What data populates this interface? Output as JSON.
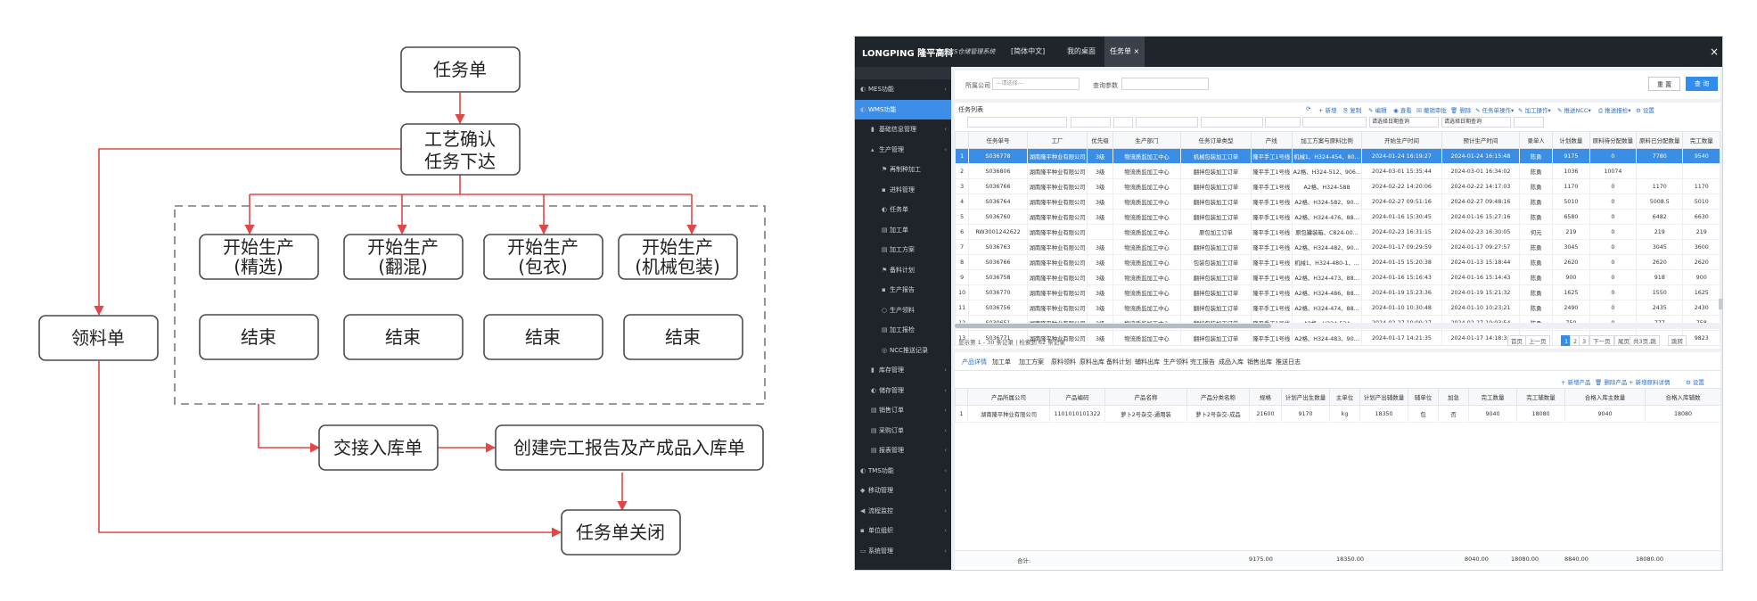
{
  "flow": {
    "nodes": {
      "task_order": "任务单",
      "confirm_line1": "工艺确认",
      "confirm_line2": "任务下达",
      "start1_line1": "开始生产",
      "start1_line2": "(精选)",
      "start2_line1": "开始生产",
      "start2_line2": "(翻混)",
      "start3_line1": "开始生产",
      "start3_line2": "(包衣)",
      "start4_line1": "开始生产",
      "start4_line2": "(机械包装)",
      "end1": "结束",
      "end2": "结束",
      "end3": "结束",
      "end4": "结束",
      "material_order": "领料单",
      "handover": "交接入库单",
      "report": "创建完工报告及产成品入库单",
      "close": "任务单关闭"
    },
    "colors": {
      "edge": "#e34646",
      "node_border": "#4a4a4a",
      "dashed_group": "#7a7a7a"
    }
  },
  "wms": {
    "brand": "LONGPING 隆平高科",
    "system_name": "WMS仓储管理系统",
    "top_tabs": [
      "[简体中文]",
      "我的桌面",
      "任务单 ×"
    ],
    "close_glyph": "×",
    "sidebar": [
      {
        "label": "MES功能",
        "level": 0,
        "icon": "◐"
      },
      {
        "label": "WMS功能",
        "level": 0,
        "icon": "◐",
        "active": true
      },
      {
        "label": "基础信息管理",
        "level": 1,
        "icon": "▮"
      },
      {
        "label": "生产管理",
        "level": 1,
        "icon": "▴"
      },
      {
        "label": "再制种加工",
        "level": 2,
        "icon": "⚑"
      },
      {
        "label": "进料管理",
        "level": 2,
        "icon": "▪"
      },
      {
        "label": "任务单",
        "level": 2,
        "icon": "◐"
      },
      {
        "label": "加工单",
        "level": 2,
        "icon": "▤"
      },
      {
        "label": "加工方案",
        "level": 2,
        "icon": "▤"
      },
      {
        "label": "备料计划",
        "level": 2,
        "icon": "⚑"
      },
      {
        "label": "生产报告",
        "level": 2,
        "icon": "▪"
      },
      {
        "label": "生产领料",
        "level": 2,
        "icon": "○"
      },
      {
        "label": "加工报检",
        "level": 2,
        "icon": "▤"
      },
      {
        "label": "NCC推送记录",
        "level": 2,
        "icon": "◎"
      },
      {
        "label": "库存管理",
        "level": 1,
        "icon": "▮"
      },
      {
        "label": "储存管理",
        "level": 1,
        "icon": "◐"
      },
      {
        "label": "销售订单",
        "level": 1,
        "icon": "▤"
      },
      {
        "label": "采购订单",
        "level": 1,
        "icon": "▤"
      },
      {
        "label": "报表管理",
        "level": 1,
        "icon": "▤"
      },
      {
        "label": "TMS功能",
        "level": 0,
        "icon": "◐"
      },
      {
        "label": "移动管理",
        "level": 0,
        "icon": "◆"
      },
      {
        "label": "流程监控",
        "level": 0,
        "icon": "◀"
      },
      {
        "label": "单位组织",
        "level": 0,
        "icon": "▪"
      },
      {
        "label": "系统管理",
        "level": 0,
        "icon": "▭"
      }
    ],
    "filter": {
      "company_label": "所属公司",
      "company_placeholder": "---请选择---",
      "param_label": "查询参数",
      "reset": "重 置",
      "query": "查 询"
    },
    "grid": {
      "title": "任务列表",
      "tools": [
        "⟳",
        "+ 新增",
        "⎘ 复制",
        "✎ 编辑",
        "◉ 查看",
        "☒ 撤销审批",
        "🗑 删除",
        "✎ 任务单操作▾",
        "✎ 加工操作▾",
        "✎ 推送NCC▾",
        "⎙ 推送报检▾",
        "⚙ 设置"
      ],
      "date_filter_a": "请选择日期查询",
      "date_filter_b": "请选择日期查询",
      "columns": [
        "",
        "任务单号",
        "工厂",
        "优先级",
        "生产部门",
        "任务订单类型",
        "产线",
        "加工方案与原料比例",
        "开始生产时间",
        "预计生产时间",
        "录单人",
        "计划数量",
        "原料待分配数量",
        "原料已分配数量",
        "完工数量"
      ],
      "rows": [
        [
          "1",
          "S036778",
          "湖南隆平种业有限公司",
          "3级",
          "物流质监加工中心",
          "机械包装加工订单",
          "隆平手工1号线",
          "机械1、H324-454、80...",
          "2024-01-24 16:19:27",
          "2024-01-24 16:15:48",
          "陈勇",
          "9175",
          "0",
          "7780",
          "9540"
        ],
        [
          "2",
          "S036806",
          "湖南隆平种业有限公司",
          "3级",
          "物流质监加工中心",
          "翻拌包装加工订单",
          "隆平手工1号线",
          "A2格、H324-512、906...",
          "2024-03-01 15:35:44",
          "2024-03-01 16:34:02",
          "陈勇",
          "1036",
          "10074",
          "",
          ""
        ],
        [
          "3",
          "S036766",
          "湖南隆平种业有限公司",
          "3级",
          "物流质监加工中心",
          "翻拌包装加工订单",
          "隆平手工1号线",
          "A2格、H324-588",
          "2024-02-22 14:20:06",
          "2024-02-22 14:17:03",
          "陈勇",
          "1170",
          "0",
          "1170",
          "1170"
        ],
        [
          "4",
          "S036764",
          "湖南隆平种业有限公司",
          "3级",
          "物流质监加工中心",
          "翻拌包装加工订单",
          "隆平手工1号线",
          "A2格、H324-582、90...",
          "2024-02-27 09:51:16",
          "2024-02-27 09:48:16",
          "陈勇",
          "5010",
          "0",
          "5008.5",
          "5010"
        ],
        [
          "5",
          "S036760",
          "湖南隆平种业有限公司",
          "3级",
          "物流质监加工中心",
          "翻拌包装加工订单",
          "隆平手工1号线",
          "A2格、H324-476、88...",
          "2024-01-16 15:30:45",
          "2024-01-16 15:27:16",
          "陈勇",
          "6580",
          "0",
          "6482",
          "6630"
        ],
        [
          "6",
          "RW3001242622",
          "湖南隆平种业有限公司",
          "",
          "物流质监加工中心",
          "原包加工订单",
          "隆平手工1号线",
          "原包罐装箱、C824-00...",
          "2024-02-23 16:31:15",
          "2024-02-23 16:30:05",
          "何元",
          "219",
          "0",
          "219",
          "219"
        ],
        [
          "7",
          "S036763",
          "湖南隆平种业有限公司",
          "3级",
          "物流质监加工中心",
          "翻拌包装加工订单",
          "隆平手工1号线",
          "A2格、H324-482、90...",
          "2024-01-17 09:29:59",
          "2024-01-17 09:27:57",
          "陈勇",
          "3045",
          "0",
          "3045",
          "3600"
        ],
        [
          "8",
          "S036766",
          "湖南隆平种业有限公司",
          "3级",
          "物流质监加工中心",
          "包装包装加工订单",
          "隆平手工1号线",
          "机械1、H324-480-1、...",
          "2024-01-15 15:20:38",
          "2024-01-13 15:18:44",
          "陈勇",
          "2620",
          "0",
          "2620",
          "2620"
        ],
        [
          "9",
          "S036758",
          "湖南隆平种业有限公司",
          "3级",
          "物流质监加工中心",
          "翻拌包装加工订单",
          "隆平手工1号线",
          "A2格、H324-473、88...",
          "2024-01-16 15:16:43",
          "2024-01-16 15:14:43",
          "陈勇",
          "900",
          "0",
          "918",
          "900"
        ],
        [
          "10",
          "S036770",
          "湖南隆平种业有限公司",
          "3级",
          "物流质监加工中心",
          "翻拌包装加工订单",
          "隆平手工1号线",
          "A2格、H324-486、88...",
          "2024-01-19 15:23:36",
          "2024-01-19 15:21:32",
          "陈勇",
          "1625",
          "0",
          "1550",
          "1625"
        ],
        [
          "11",
          "S036756",
          "湖南隆平种业有限公司",
          "3级",
          "物流质监加工中心",
          "翻拌包装加工订单",
          "隆平手工1号线",
          "A2格、H324-474、88...",
          "2024-01-10 10:30:48",
          "2024-01-10 10:23:21",
          "陈勇",
          "2490",
          "0",
          "2435",
          "2430"
        ],
        [
          "12",
          "S030651",
          "湖南隆平种业有限公司",
          "3级",
          "物流质监加工中心",
          "翻拌包装加工订单",
          "隆平手工1号线",
          "A2格、H324-534",
          "2024-02-27 10:00:27",
          "2024-02-27 10:03:54",
          "陈勇",
          "750",
          "0",
          "777",
          "758"
        ],
        [
          "13",
          "S036771",
          "湖南隆平种业有限公司",
          "3级",
          "物流质监加工中心",
          "翻拌包装加工订单",
          "隆平手工1号线",
          "A2格、H324-483、90...",
          "2024-01-17 14:21:35",
          "2024-01-17 14:18:33",
          "陈勇",
          "10080",
          "9690",
          "",
          "9823"
        ]
      ],
      "pager_info": "显示第 1 - 30 条记录 | 检索到 62 条记录",
      "pager_buttons": [
        "首页",
        "上一页",
        "1",
        "2",
        "3",
        "下一页",
        "尾页",
        "共3页,跳",
        "跳转"
      ]
    },
    "detail": {
      "tabs": [
        "产品详情",
        "加工单",
        "加工方案",
        "原料领料",
        "原料出库",
        "备料计划",
        "辅料出库",
        "生产领料",
        "完工报告",
        "成品入库",
        "销售出库",
        "推送日志"
      ],
      "tools": [
        "+ 新增产品",
        "🗑 删除产品",
        "+ 新增原料详情",
        "⚙ 设置"
      ],
      "columns": [
        "",
        "产品所属公司",
        "产品编码",
        "产品名称",
        "产品分类名称",
        "规格",
        "计划产出生数量",
        "主单位",
        "计划产出辅数量",
        "辅单位",
        "加急",
        "完工数量",
        "完工辅数量",
        "合格入库主数量",
        "合格入库辅数"
      ],
      "rows": [
        [
          "1",
          "湖南隆平种业有限公司",
          "1101010101322",
          "萝卜2号杂交-通用装",
          "萝卜2号杂交-成品",
          "21600",
          "9170",
          "kg",
          "18350",
          "包",
          "否",
          "9040",
          "18080",
          "9040",
          "18080"
        ]
      ],
      "totals_label": "合计:",
      "totals": [
        "9175.00",
        "18350.00",
        "8040.00",
        "18080.00",
        "8840.00",
        "18080.00"
      ]
    }
  }
}
